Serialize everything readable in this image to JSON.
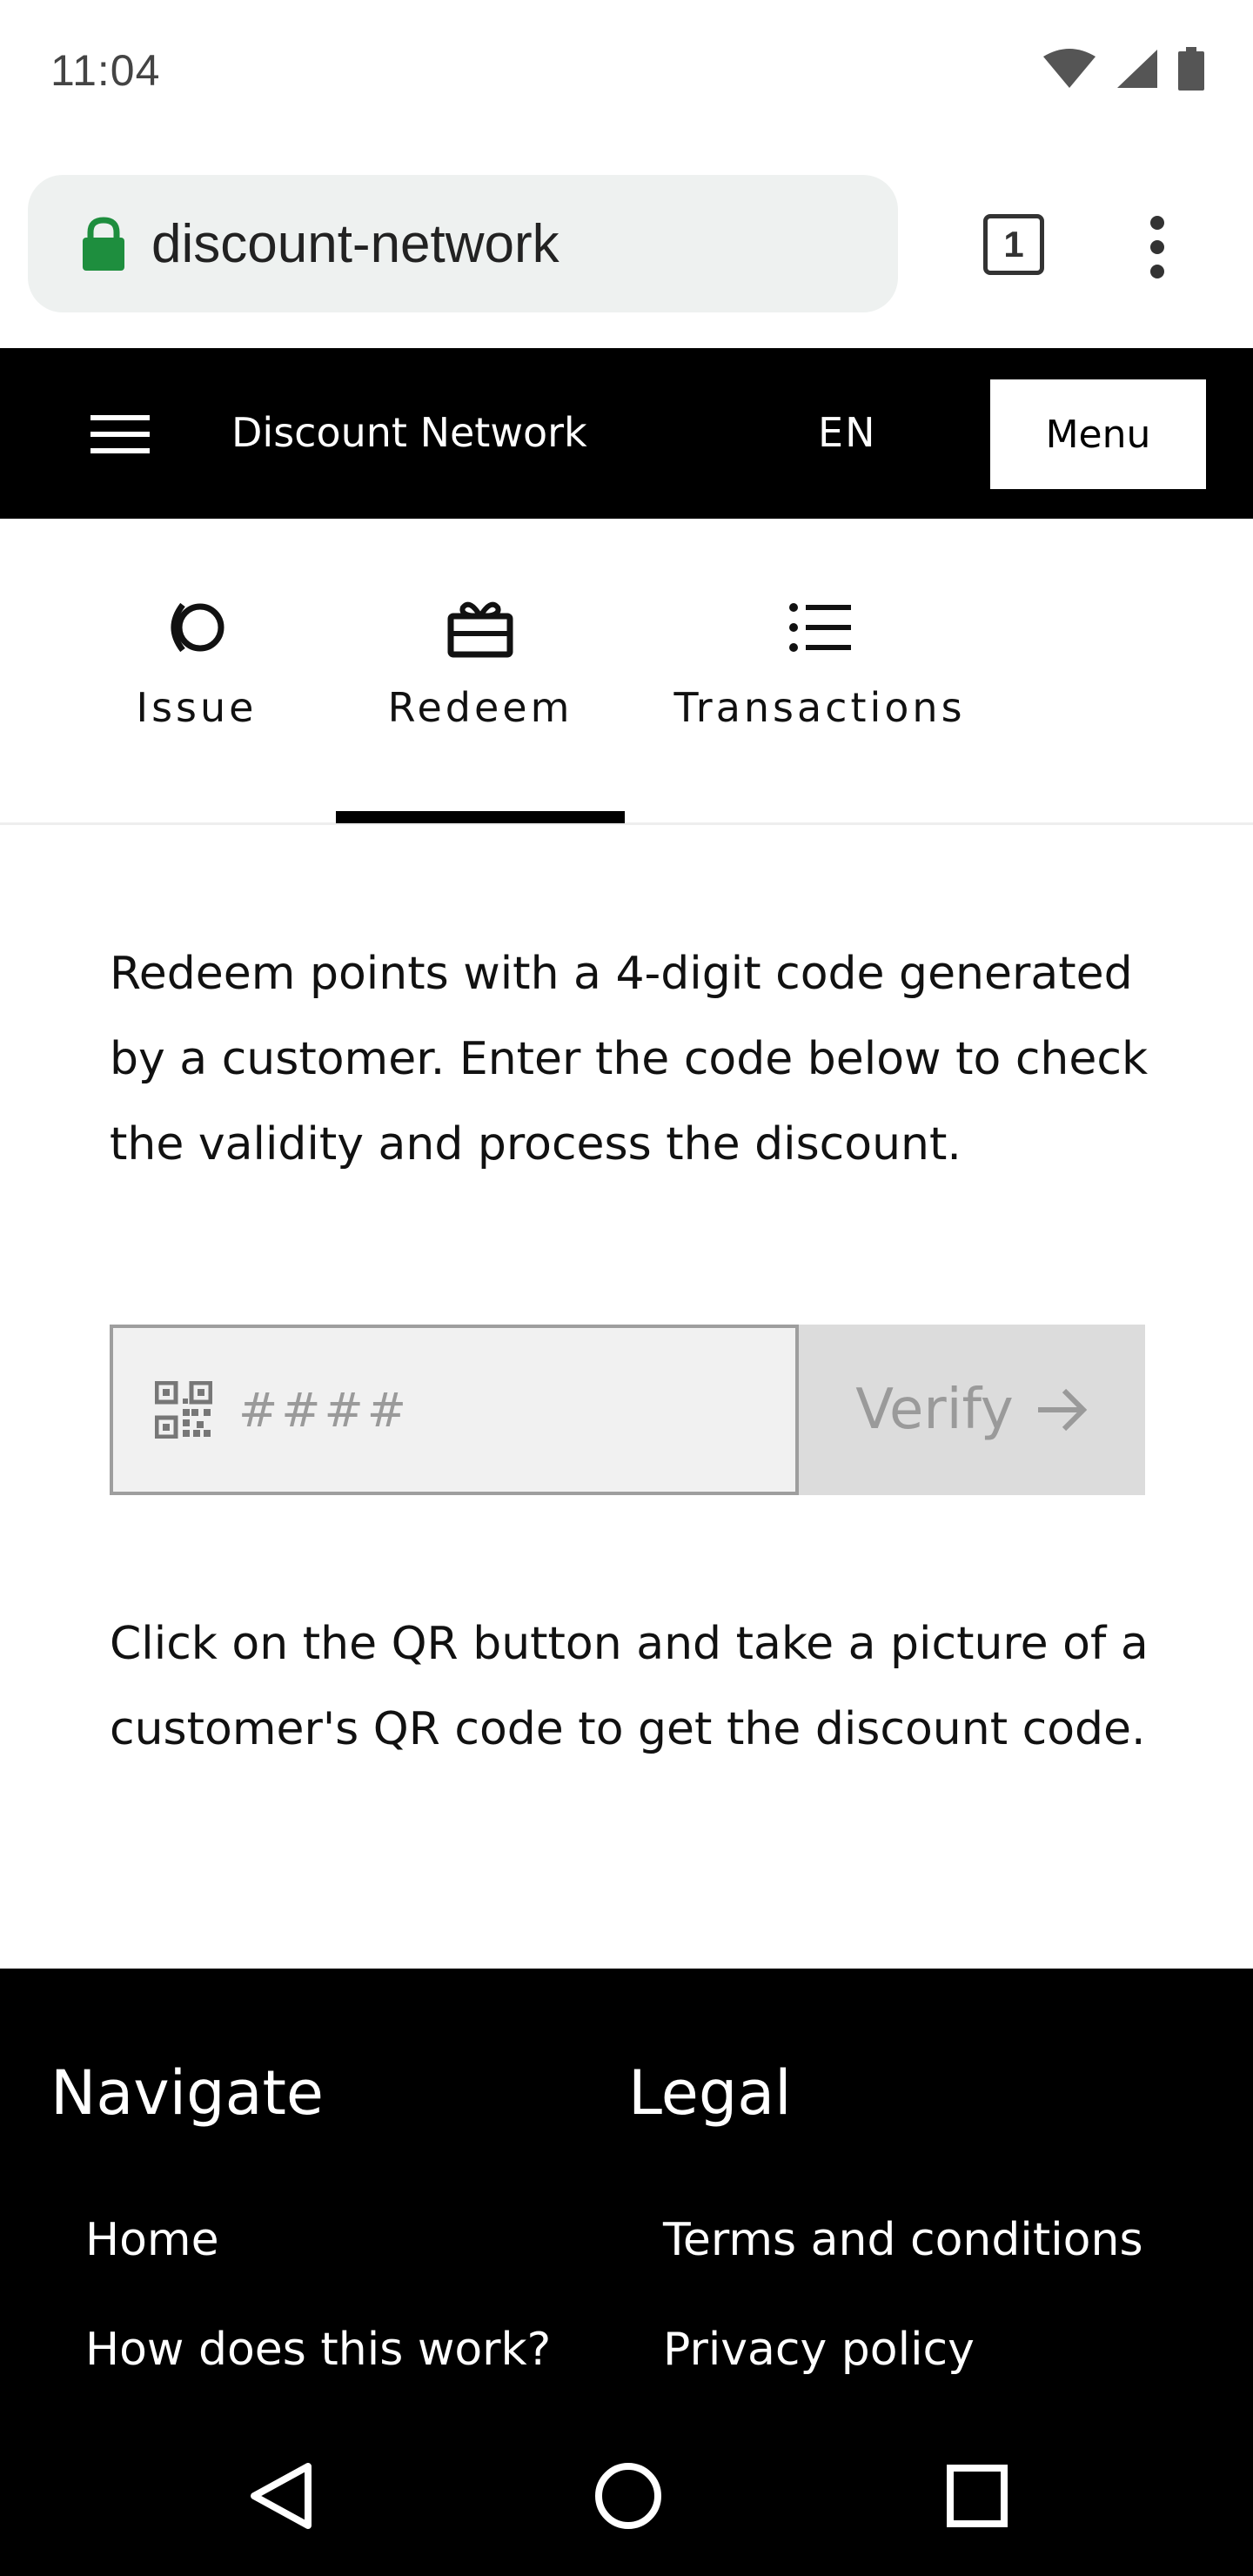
{
  "status_bar": {
    "time": "11:04",
    "icons": [
      "wifi-icon",
      "signal-icon",
      "battery-icon"
    ]
  },
  "browser": {
    "url": "discount-network",
    "tab_count": "1",
    "lock_color": "#1e8e3e"
  },
  "header": {
    "site_name": "Discount Network",
    "language": "EN",
    "menu_label": "Menu"
  },
  "tabs": [
    {
      "label": "Issue",
      "icon": "issue-icon"
    },
    {
      "label": "Redeem",
      "icon": "gift-icon",
      "active": true
    },
    {
      "label": "Transactions",
      "icon": "list-icon"
    }
  ],
  "main": {
    "intro": "Redeem points with a 4-digit code generated by a customer. Enter the code below to check the validity and process the discount.",
    "code_placeholder": "####",
    "verify_label": "Verify",
    "qr_hint": "Click on the QR button and take a picture of a customer's QR code to get the discount code."
  },
  "footer": {
    "navigate": {
      "heading": "Navigate",
      "links": [
        "Home",
        "How does this work?"
      ]
    },
    "legal": {
      "heading": "Legal",
      "links": [
        "Terms and conditions",
        "Privacy policy"
      ]
    }
  }
}
